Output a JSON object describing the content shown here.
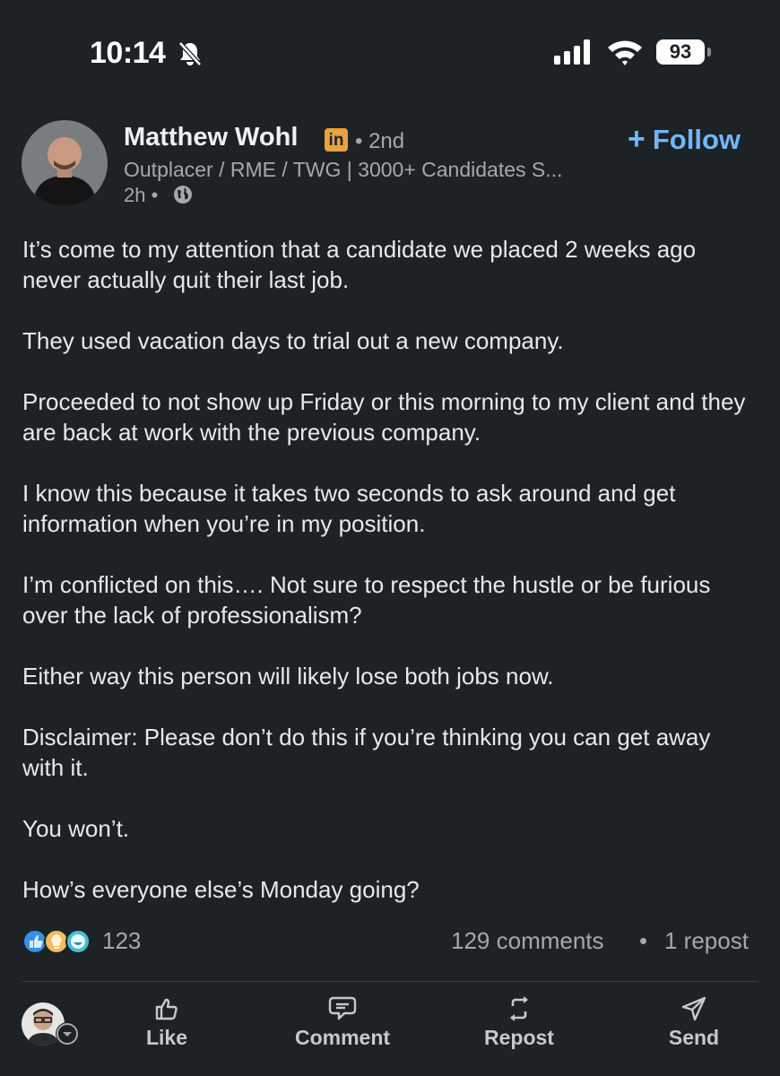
{
  "status_bar": {
    "time": "10:14",
    "battery": "93",
    "icons": [
      "bell-slash-icon",
      "cellular-signal-icon",
      "wifi-icon",
      "battery-icon"
    ]
  },
  "post": {
    "author": {
      "name": "Matthew Wohl",
      "badge_icon": "linkedin-premium-icon",
      "badge_text": "in",
      "degree": "• 2nd",
      "headline": "Outplacer / RME / TWG | 3000+ Candidates S...",
      "time": "2h •",
      "visibility_icon": "globe-icon"
    },
    "follow_label": "Follow",
    "paragraphs": [
      "It’s come to my attention that a candidate we placed 2 weeks ago never actually quit their last job.",
      "They used vacation days to trial out a new company.",
      "Proceeded to not show up Friday or this morning to my client and they are back at work with the previous company.",
      "I know this because it takes two seconds to ask around and get information when you’re in my position.",
      "I’m conflicted on this…. Not sure to respect the hustle or be furious over the lack of professionalism?",
      "Either way this person will likely lose both jobs now.",
      "Disclaimer: Please don’t do this if you’re thinking you can get away with it.",
      "You won’t.",
      "How’s everyone else’s Monday going?"
    ],
    "social": {
      "reaction_icons": [
        "like-reaction-icon",
        "insightful-reaction-icon",
        "funny-reaction-icon"
      ],
      "reaction_count": "123",
      "comments": "129 comments",
      "separator": "•",
      "reposts": "1 repost"
    }
  },
  "actions": {
    "like": "Like",
    "comment": "Comment",
    "repost": "Repost",
    "send": "Send"
  },
  "colors": {
    "background": "#1d2226",
    "accent": "#71b7fb",
    "muted_text": "#a8a8a8",
    "premium_badge": "#e7a33e"
  }
}
